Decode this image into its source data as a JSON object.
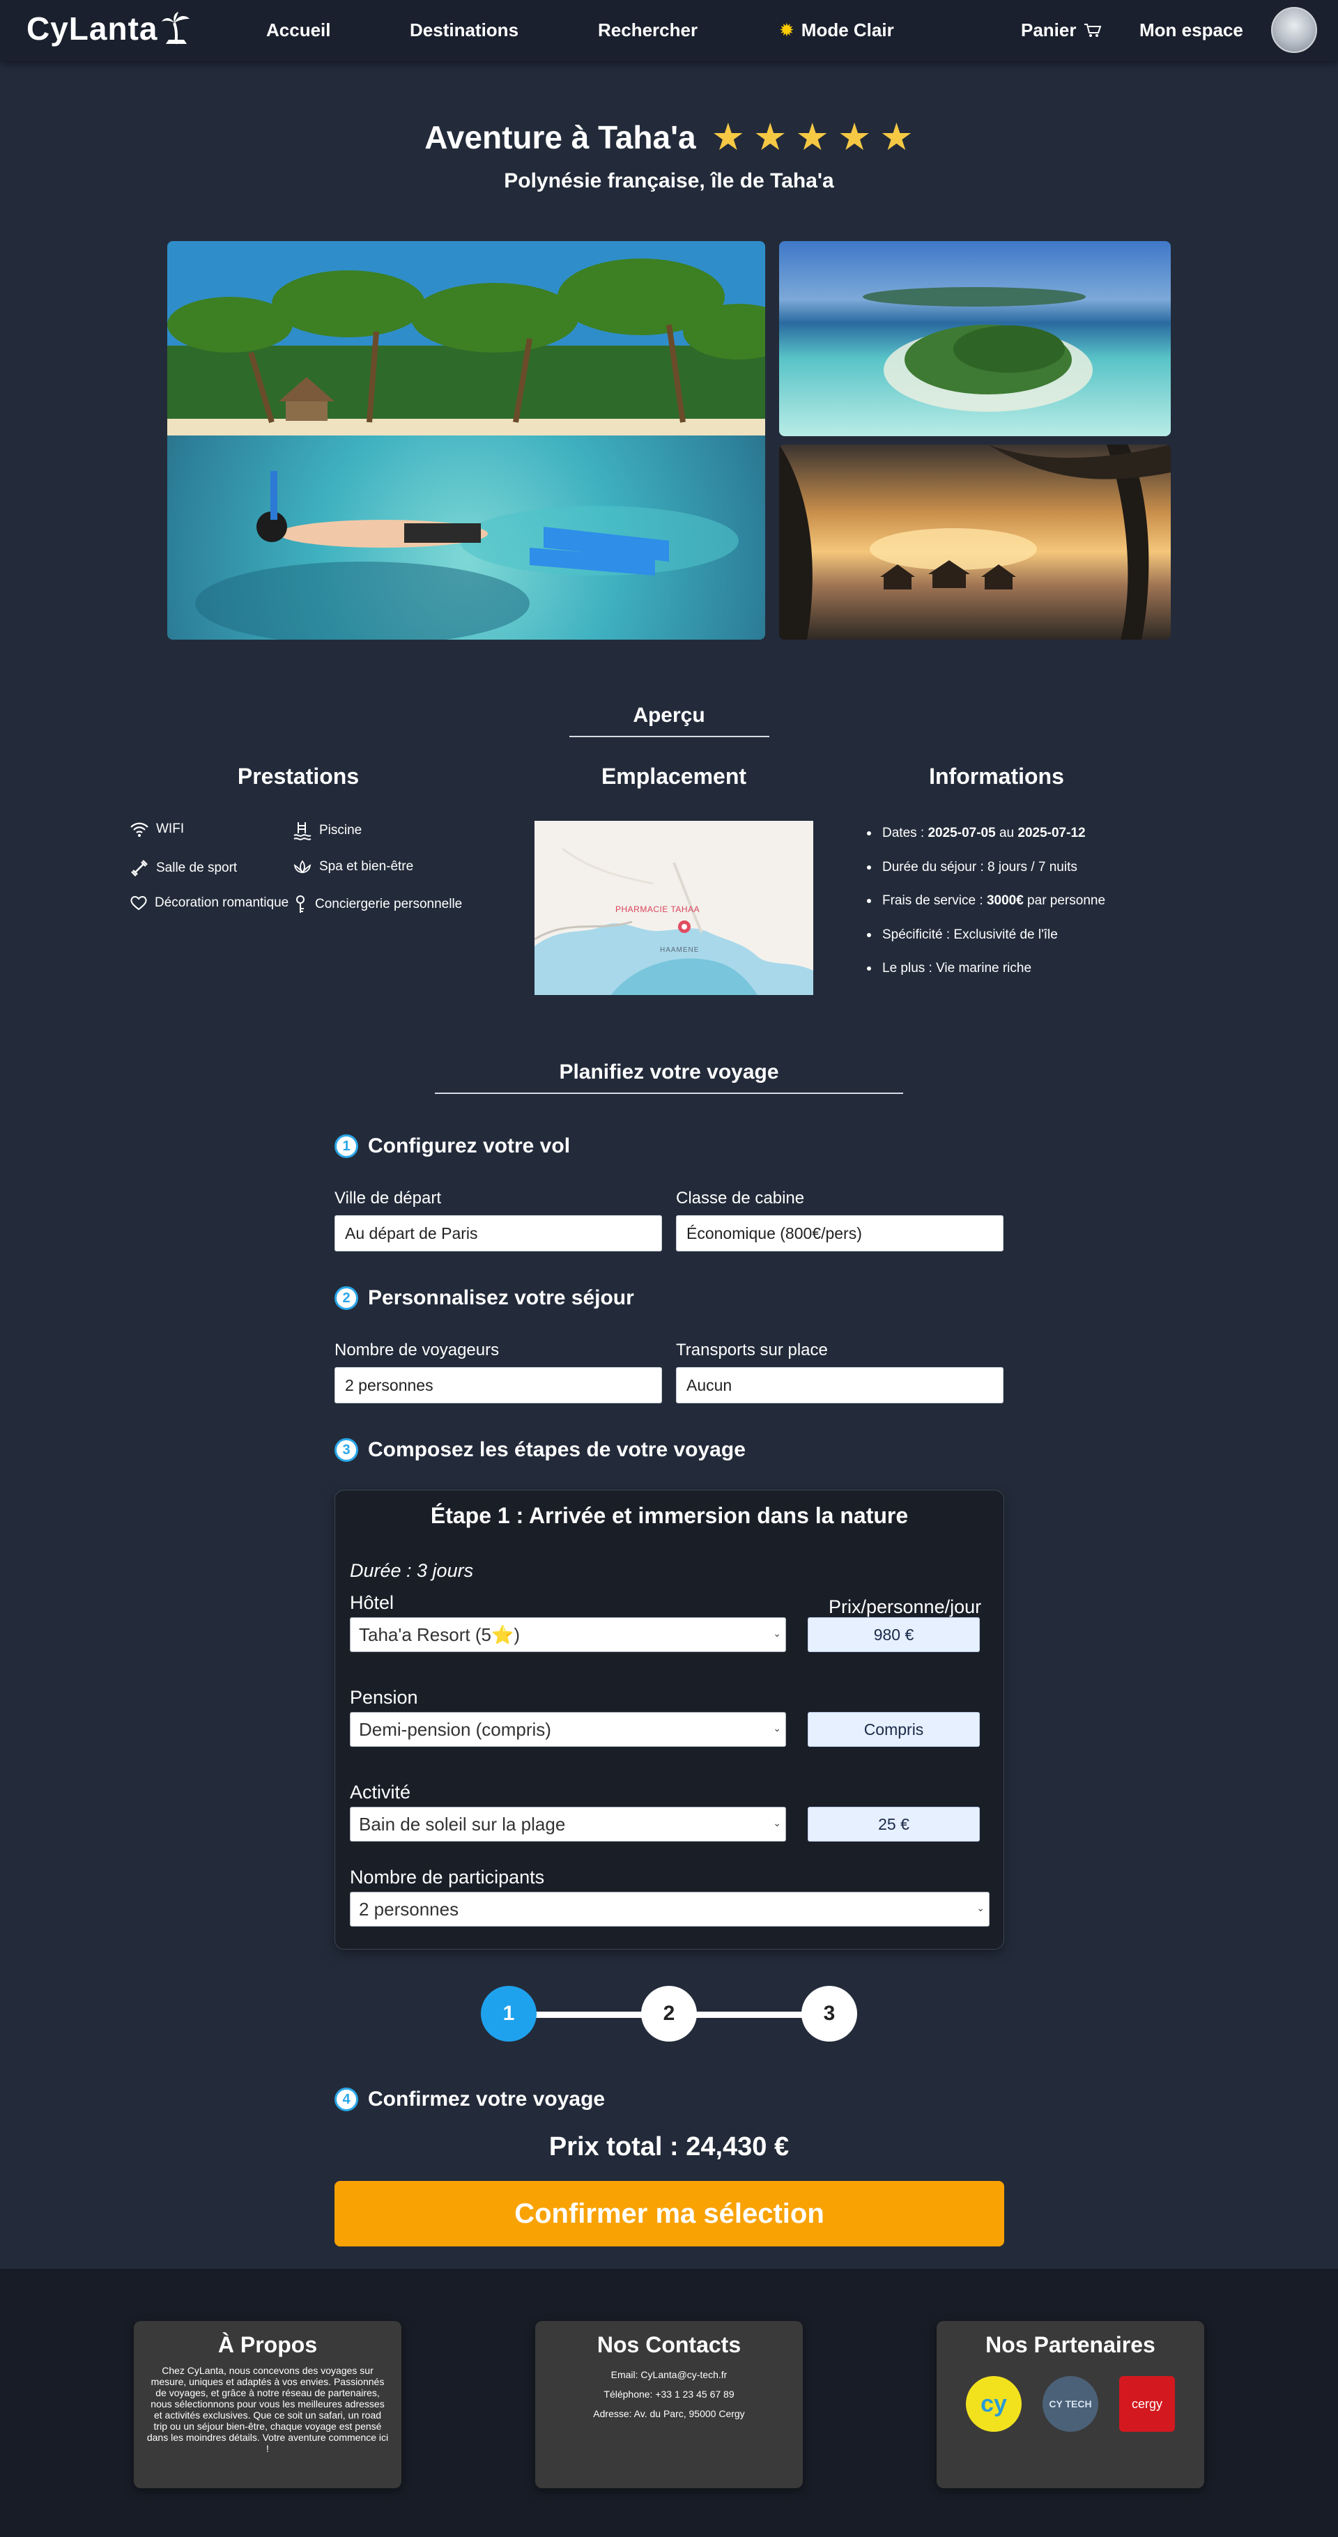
{
  "nav": {
    "brand": "CyLanta",
    "links": [
      "Accueil",
      "Destinations",
      "Rechercher"
    ],
    "mode": "Mode Clair",
    "cart": "Panier",
    "account": "Mon espace"
  },
  "hero": {
    "title": "Aventure à Taha'a",
    "rating": 5,
    "subtitle": "Polynésie française, île de Taha'a"
  },
  "overview": {
    "heading": "Aperçu",
    "prestations_title": "Prestations",
    "emplacement_title": "Emplacement",
    "informations_title": "Informations",
    "amenities": [
      {
        "label": "WIFI",
        "icon": "wifi-icon"
      },
      {
        "label": "Piscine",
        "icon": "pool-icon"
      },
      {
        "label": "Salle de sport",
        "icon": "dumbbell-icon"
      },
      {
        "label": "Spa et bien-être",
        "icon": "spa-icon"
      },
      {
        "label": "Décoration romantique",
        "icon": "heart-icon"
      },
      {
        "label": "Conciergerie personnelle",
        "icon": "concierge-icon"
      }
    ],
    "map": {
      "pin_label": "PHARMACIE TAHAA",
      "place_label": "HAAMENE"
    },
    "info": {
      "dates_label": "Dates : ",
      "date_start": "2025-07-05",
      "dates_mid": " au ",
      "date_end": "2025-07-12",
      "duration": "Durée du séjour : 8 jours / 7 nuits",
      "fees_label": "Frais de service : ",
      "fees_value": "3000€",
      "fees_suffix": " par personne",
      "specificity": "Spécificité : Exclusivité de l'île",
      "plus": "Le plus : Vie marine riche"
    }
  },
  "plan": {
    "heading": "Planifiez votre voyage",
    "step1": {
      "num": "1",
      "title": "Configurez votre vol",
      "departure_label": "Ville de départ",
      "departure_value": "Au départ de Paris",
      "cabin_label": "Classe de cabine",
      "cabin_value": "Économique (800€/pers)"
    },
    "step2": {
      "num": "2",
      "title": "Personnalisez votre séjour",
      "travelers_label": "Nombre de voyageurs",
      "travelers_value": "2 personnes",
      "transport_label": "Transports sur place",
      "transport_value": "Aucun"
    },
    "step3": {
      "num": "3",
      "title": "Composez les étapes de votre voyage",
      "stage": {
        "title": "Étape 1 : Arrivée et immersion dans la nature",
        "duration": "Durée : 3 jours",
        "price_header": "Prix/personne/jour",
        "hotel_label": "Hôtel",
        "hotel_value": "Taha'a Resort (5⭐)",
        "hotel_price": "980 €",
        "pension_label": "Pension",
        "pension_value": "Demi-pension (compris)",
        "pension_price": "Compris",
        "activity_label": "Activité",
        "activity_value": "Bain de soleil sur la plage",
        "activity_price": "25 €",
        "participants_label": "Nombre de participants",
        "participants_value": "2 personnes"
      },
      "progress": {
        "steps": [
          "1",
          "2",
          "3"
        ],
        "current": 1
      }
    },
    "step4": {
      "num": "4",
      "title": "Confirmez votre voyage",
      "total": "Prix total : 24,430 €",
      "confirm_label": "Confirmer ma sélection"
    }
  },
  "footer": {
    "about_title": "À Propos",
    "about_text": "Chez CyLanta, nous concevons des voyages sur mesure, uniques et adaptés à vos envies. Passionnés de voyages, et grâce à notre réseau de partenaires, nous sélectionnons pour vous les meilleures adresses et activités exclusives. Que ce soit un safari, un road trip ou un séjour bien-être, chaque voyage est pensé dans les moindres détails. Votre aventure commence ici !",
    "contacts_title": "Nos Contacts",
    "email": "Email: CyLanta@cy-tech.fr",
    "phone": "Téléphone: +33 1 23 45 67 89",
    "address": "Adresse: Av. du Parc, 95000 Cergy",
    "partners_title": "Nos Partenaires",
    "partners": [
      "cy",
      "CY TECH",
      "cergy"
    ]
  },
  "colors": {
    "background": "#232b3a",
    "navbar": "#1a202d",
    "accent_blue": "#1fa2ee",
    "confirm_orange": "#f9a204",
    "star": "#f6c945"
  }
}
